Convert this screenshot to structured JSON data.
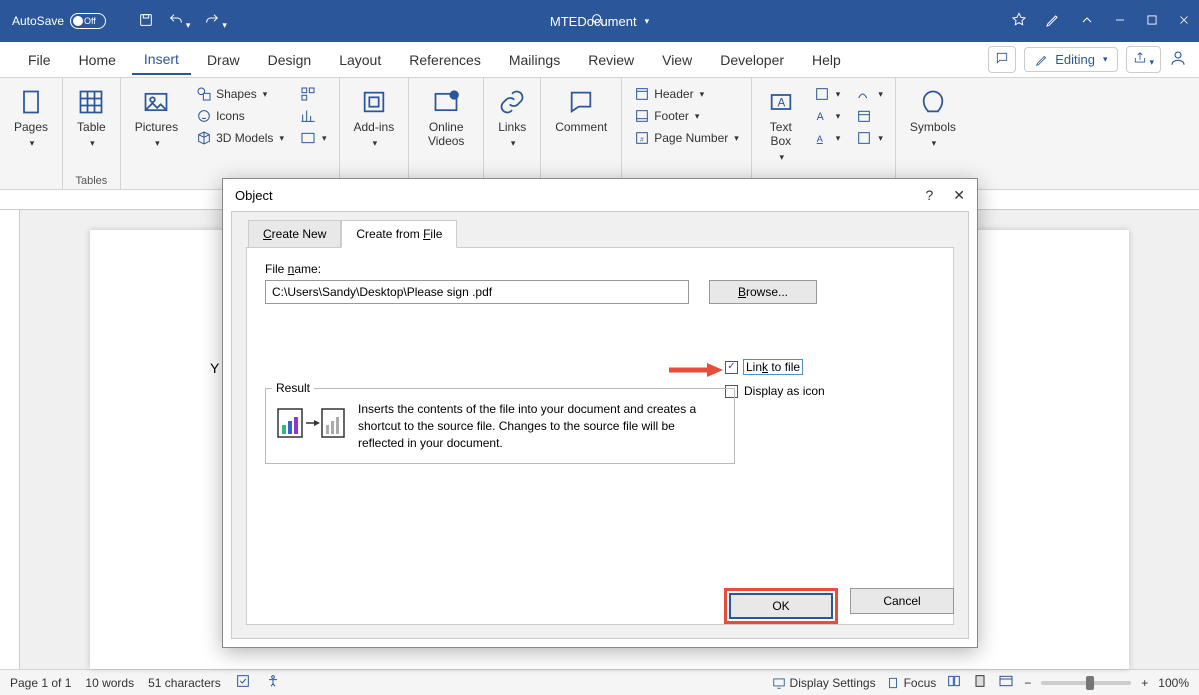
{
  "titlebar": {
    "autosave_label": "AutoSave",
    "autosave_state": "Off",
    "doc_name": "MTEDocument"
  },
  "tabs": {
    "file": "File",
    "home": "Home",
    "insert": "Insert",
    "draw": "Draw",
    "design": "Design",
    "layout": "Layout",
    "references": "References",
    "mailings": "Mailings",
    "review": "Review",
    "view": "View",
    "developer": "Developer",
    "help": "Help",
    "editing": "Editing"
  },
  "ribbon": {
    "pages": "Pages",
    "table": "Table",
    "tables": "Tables",
    "pictures": "Pictures",
    "shapes": "Shapes",
    "icons": "Icons",
    "models3d": "3D Models",
    "addins": "Add-ins",
    "online_videos": "Online Videos",
    "links": "Links",
    "comment": "Comment",
    "header": "Header",
    "footer": "Footer",
    "page_number": "Page Number",
    "text_box": "Text Box",
    "symbols": "Symbols"
  },
  "dialog": {
    "title": "Object",
    "tab_create_new": "Create New",
    "tab_create_from_file": "Create from File",
    "file_name_label_pre": "File ",
    "file_name_label_u": "n",
    "file_name_label_post": "ame:",
    "file_name_value": "C:\\Users\\Sandy\\Desktop\\Please sign .pdf",
    "browse": "Browse...",
    "link_to_file": "Link to file",
    "display_as_icon": "Display as icon",
    "result_legend": "Result",
    "result_text": "Inserts the contents of the file into your document and creates a shortcut to the source file.  Changes to the source file will be reflected in your document.",
    "ok": "OK",
    "cancel": "Cancel"
  },
  "page": {
    "partial_text": "Y"
  },
  "status": {
    "page": "Page 1 of 1",
    "words": "10 words",
    "chars": "51 characters",
    "display_settings": "Display Settings",
    "focus": "Focus",
    "zoom": "100%"
  }
}
